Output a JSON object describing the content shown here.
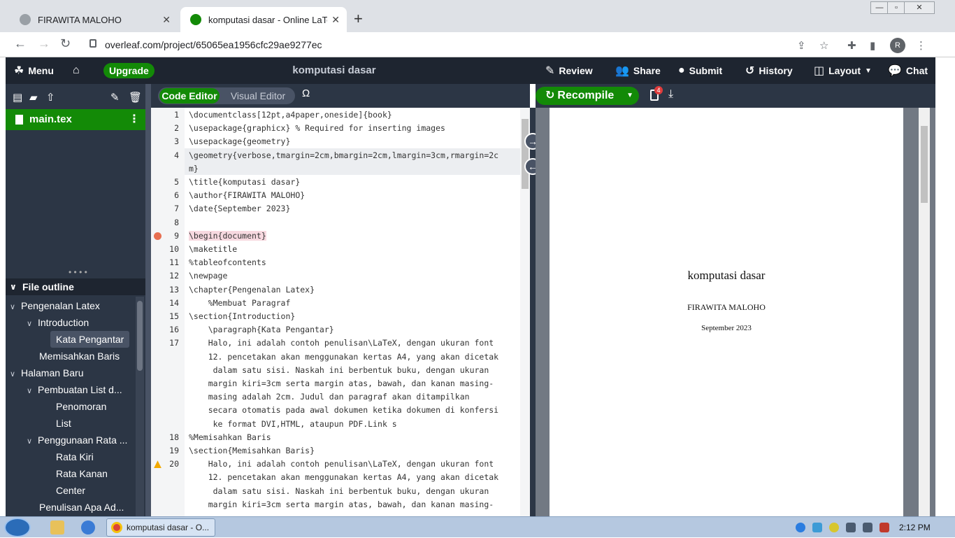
{
  "browser": {
    "tabs": [
      {
        "title": "FIRAWITA MALOHO",
        "active": false
      },
      {
        "title": "komputasi dasar - Online LaTeX",
        "active": true
      }
    ],
    "url": "overleaf.com/project/65065ea1956cfc29ae9277ec",
    "profile_initial": "R"
  },
  "toolbar": {
    "menu": "Menu",
    "upgrade": "Upgrade",
    "project_title": "komputasi dasar",
    "review": "Review",
    "share": "Share",
    "submit": "Submit",
    "history": "History",
    "layout": "Layout",
    "chat": "Chat"
  },
  "files": {
    "main_file": "main.tex"
  },
  "outline": {
    "heading": "File outline",
    "items": [
      {
        "label": "Pengenalan Latex",
        "level": 0,
        "expanded": true
      },
      {
        "label": "Introduction",
        "level": 1,
        "expanded": true
      },
      {
        "label": "Kata Pengantar",
        "level": 2,
        "selected": true
      },
      {
        "label": "Memisahkan Baris",
        "level": 1
      },
      {
        "label": "Halaman Baru",
        "level": 0,
        "expanded": true
      },
      {
        "label": "Pembuatan List d...",
        "level": 1,
        "expanded": true
      },
      {
        "label": "Penomoran",
        "level": 2
      },
      {
        "label": "List",
        "level": 2
      },
      {
        "label": "Penggunaan Rata ...",
        "level": 1,
        "expanded": true
      },
      {
        "label": "Rata Kiri",
        "level": 2
      },
      {
        "label": "Rata Kanan",
        "level": 2
      },
      {
        "label": "Center",
        "level": 2
      },
      {
        "label": "Penulisan Apa Ad...",
        "level": 1
      }
    ]
  },
  "editor": {
    "code_editor_label": "Code Editor",
    "visual_editor_label": "Visual Editor",
    "symbol": "Ω",
    "lines": [
      {
        "num": "1",
        "text": "\\documentclass[12pt,a4paper,oneside]{book}"
      },
      {
        "num": "2",
        "text": "\\usepackage{graphicx} % Required for inserting images"
      },
      {
        "num": "3",
        "text": "\\usepackage{geometry}"
      },
      {
        "num": "4",
        "text": "\\geometry{verbose,tmargin=2cm,bmargin=2cm,lmargin=3cm,rmargin=2c"
      },
      {
        "num": "",
        "text": "m}"
      },
      {
        "num": "5",
        "text": "\\title{komputasi dasar}"
      },
      {
        "num": "6",
        "text": "\\author{FIRAWITA MALOHO}"
      },
      {
        "num": "7",
        "text": "\\date{September 2023}"
      },
      {
        "num": "8",
        "text": ""
      },
      {
        "num": "9",
        "text": "\\begin{document}",
        "marker": "error"
      },
      {
        "num": "10",
        "text": "\\maketitle"
      },
      {
        "num": "11",
        "text": "%tableofcontents"
      },
      {
        "num": "12",
        "text": "\\newpage"
      },
      {
        "num": "13",
        "text": "\\chapter{Pengenalan Latex}"
      },
      {
        "num": "14",
        "text": "    %Membuat Paragraf"
      },
      {
        "num": "15",
        "text": "\\section{Introduction}"
      },
      {
        "num": "16",
        "text": "    \\paragraph{Kata Pengantar}"
      },
      {
        "num": "17",
        "text": "    Halo, ini adalah contoh penulisan\\LaTeX, dengan ukuran font"
      },
      {
        "num": "",
        "text": "    12. pencetakan akan menggunakan kertas A4, yang akan dicetak"
      },
      {
        "num": "",
        "text": "     dalam satu sisi. Naskah ini berbentuk buku, dengan ukuran"
      },
      {
        "num": "",
        "text": "    margin kiri=3cm serta margin atas, bawah, dan kanan masing-"
      },
      {
        "num": "",
        "text": "    masing adalah 2cm. Judul dan paragraf akan ditampilkan"
      },
      {
        "num": "",
        "text": "    secara otomatis pada awal dokumen ketika dokumen di konfersi"
      },
      {
        "num": "",
        "text": "     ke format DVI,HTML, ataupun PDF.Link s"
      },
      {
        "num": "18",
        "text": "%Memisahkan Baris"
      },
      {
        "num": "19",
        "text": "\\section{Memisahkan Baris}"
      },
      {
        "num": "20",
        "text": "    Halo, ini adalah contoh penulisan\\LaTeX, dengan ukuran font",
        "marker": "warning"
      },
      {
        "num": "",
        "text": "    12. pencetakan akan menggunakan kertas A4, yang akan dicetak"
      },
      {
        "num": "",
        "text": "     dalam satu sisi. Naskah ini berbentuk buku, dengan ukuran"
      },
      {
        "num": "",
        "text": "    margin kiri=3cm serta margin atas, bawah, dan kanan masing-"
      }
    ]
  },
  "pdf": {
    "recompile": "Recompile",
    "logs_count": "4",
    "title": "komputasi dasar",
    "author": "FIRAWITA MALOHO",
    "date": "September 2023"
  },
  "taskbar": {
    "active_window": "komputasi dasar - O...",
    "time": "2:12 PM"
  },
  "colors": {
    "overleaf_green": "#138a07",
    "toolbar_bg": "#1e2530",
    "panel_bg": "#2c3645",
    "error": "#e76f51",
    "warning": "#f2a900"
  }
}
